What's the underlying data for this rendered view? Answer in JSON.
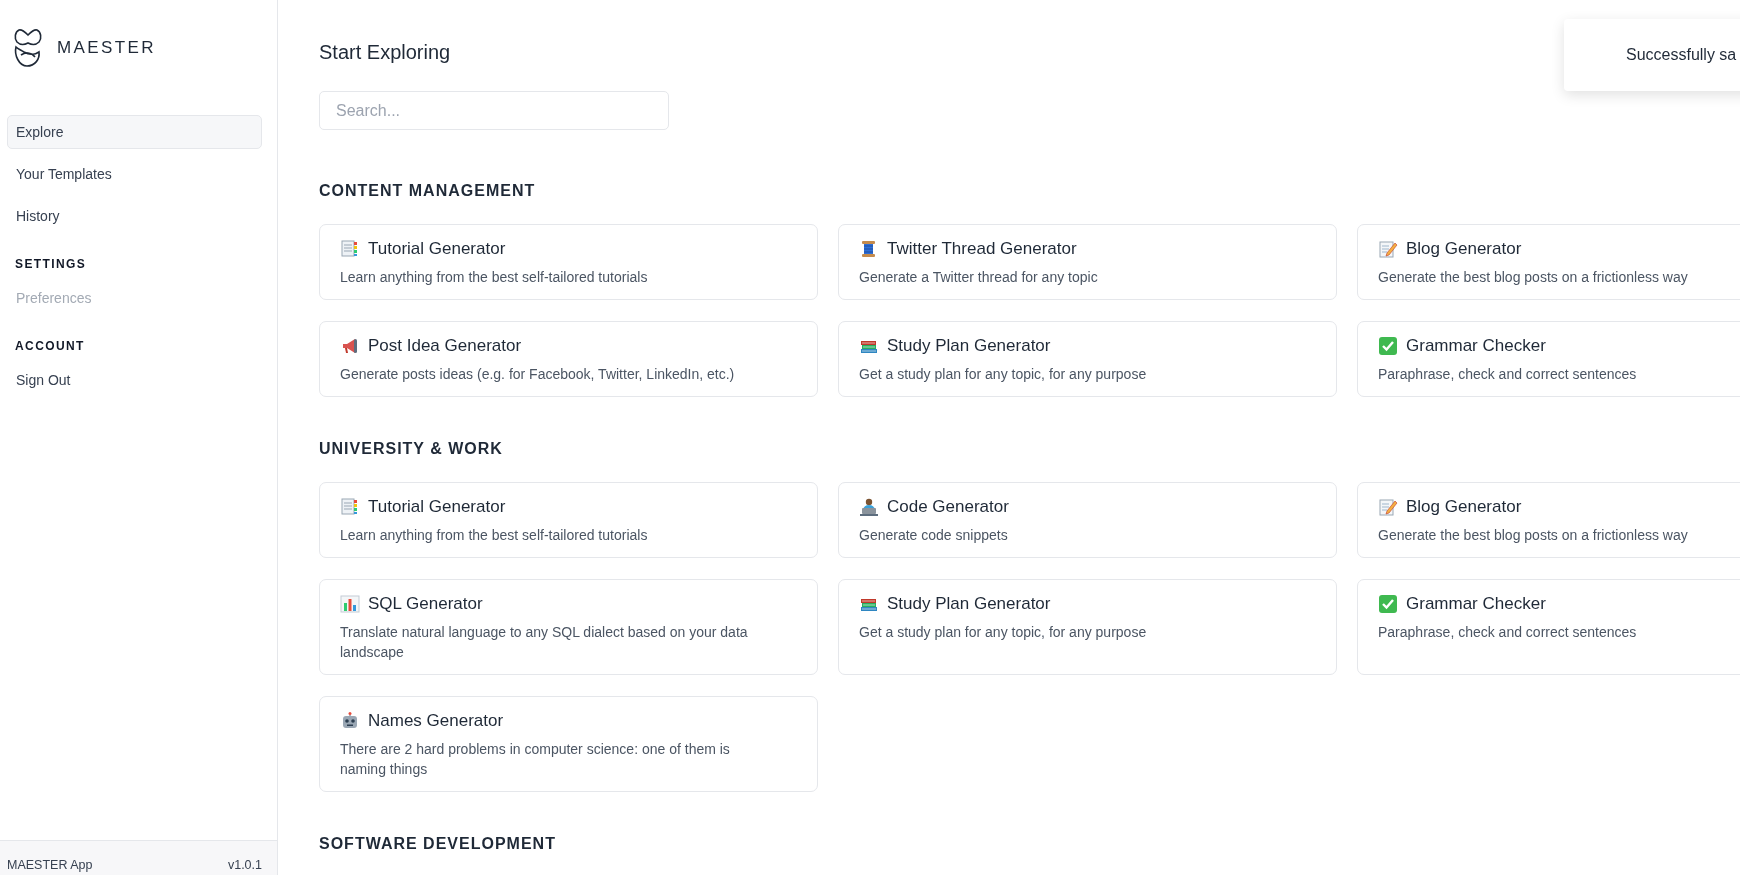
{
  "brand": {
    "name": "MAESTER"
  },
  "nav": {
    "items": [
      {
        "label": "Explore",
        "selected": true
      },
      {
        "label": "Your Templates",
        "selected": false
      },
      {
        "label": "History",
        "selected": false
      }
    ]
  },
  "sidebar_sections": [
    {
      "heading": "SETTINGS",
      "items": [
        {
          "label": "Preferences",
          "disabled": true
        }
      ]
    },
    {
      "heading": "ACCOUNT",
      "items": [
        {
          "label": "Sign Out",
          "disabled": false
        }
      ]
    }
  ],
  "footer": {
    "app_name": "MAESTER App",
    "version": "v1.0.1"
  },
  "page_title": "Start Exploring",
  "search": {
    "placeholder": "Search..."
  },
  "sections": [
    {
      "heading": "CONTENT MANAGEMENT",
      "cards": [
        {
          "kind": "document",
          "title": "Tutorial Generator",
          "description": "Learn anything from the best self-tailored tutorials"
        },
        {
          "kind": "spool",
          "title": "Twitter Thread Generator",
          "description": "Generate a Twitter thread for any topic"
        },
        {
          "kind": "memo",
          "title": "Blog Generator",
          "description": "Generate the best blog posts on a frictionless way"
        },
        {
          "kind": "megaphone",
          "title": "Post Idea Generator",
          "description": "Generate posts ideas (e.g. for Facebook, Twitter, LinkedIn, etc.)"
        },
        {
          "kind": "books",
          "title": "Study Plan Generator",
          "description": "Get a study plan for any topic, for any purpose"
        },
        {
          "kind": "check",
          "title": "Grammar Checker",
          "description": "Paraphrase, check and correct sentences"
        }
      ]
    },
    {
      "heading": "UNIVERSITY & WORK",
      "cards": [
        {
          "kind": "document",
          "title": "Tutorial Generator",
          "description": "Learn anything from the best self-tailored tutorials"
        },
        {
          "kind": "laptop",
          "title": "Code Generator",
          "description": "Generate code snippets"
        },
        {
          "kind": "memo",
          "title": "Blog Generator",
          "description": "Generate the best blog posts on a frictionless way"
        },
        {
          "kind": "chart",
          "title": "SQL Generator",
          "description": "Translate natural language to any SQL dialect based on your data landscape"
        },
        {
          "kind": "books",
          "title": "Study Plan Generator",
          "description": "Get a study plan for any topic, for any purpose"
        },
        {
          "kind": "check",
          "title": "Grammar Checker",
          "description": "Paraphrase, check and correct sentences"
        },
        {
          "kind": "robot",
          "title": "Names Generator",
          "description": "There are 2 hard problems in computer science: one of them is naming things"
        }
      ]
    },
    {
      "heading": "SOFTWARE DEVELOPMENT"
    }
  ],
  "toast": {
    "message": "Successfully sa"
  }
}
